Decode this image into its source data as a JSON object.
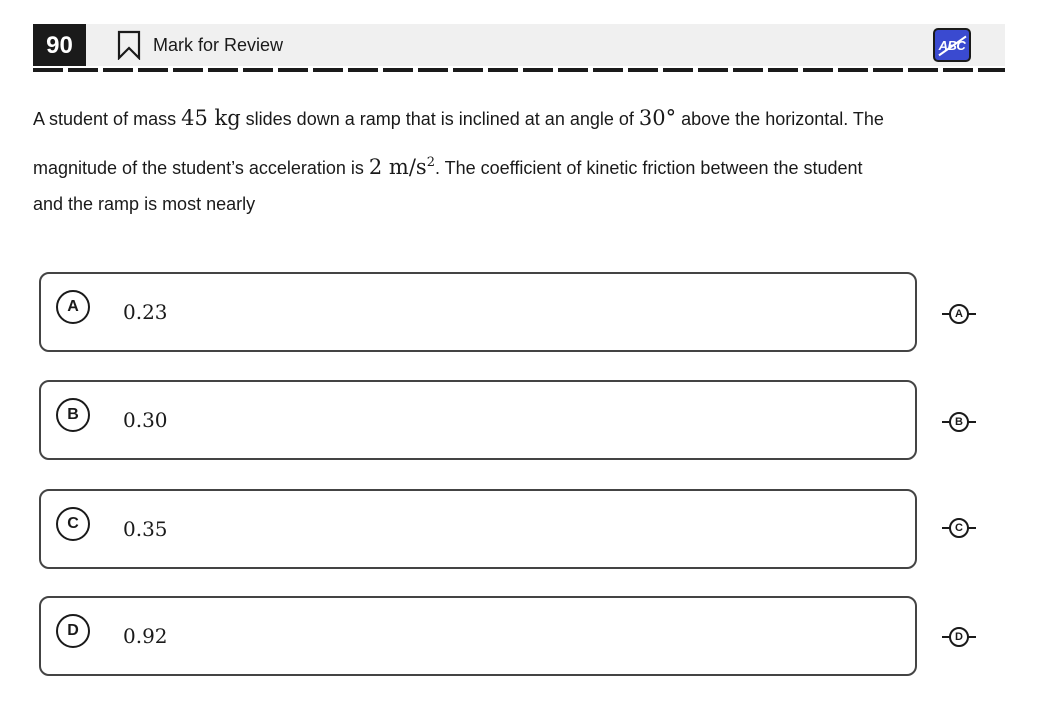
{
  "header": {
    "question_number": "90",
    "mark_label": "Mark for Review",
    "abc_label": "ABC"
  },
  "question": {
    "text_1": "A student of mass ",
    "mass": "45 kg",
    "text_2": " slides down a ramp that is inclined at an angle of ",
    "angle": "30°",
    "text_3": " above the horizontal. The",
    "text_4": "magnitude of the student’s acceleration is ",
    "accel": "2 m/s",
    "accel_exp": "2",
    "text_5": ". The coefficient of kinetic friction between the student",
    "text_6": "and the ramp is most nearly"
  },
  "options": [
    {
      "letter": "A",
      "value": "0.23"
    },
    {
      "letter": "B",
      "value": "0.30"
    },
    {
      "letter": "C",
      "value": "0.35"
    },
    {
      "letter": "D",
      "value": "0.92"
    }
  ],
  "icons": {
    "bookmark": "bookmark-icon",
    "abc": "abc-strikethrough-icon"
  },
  "colors": {
    "header_bg": "#f0f0f0",
    "qnum_bg": "#1a1a1a",
    "abc_bg": "#3a4ad0"
  }
}
